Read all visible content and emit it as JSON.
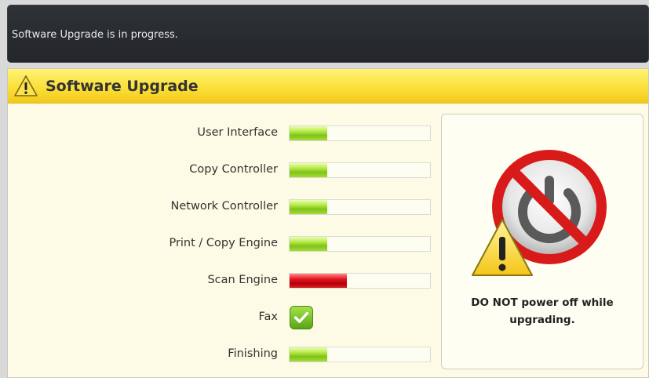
{
  "status_bar": {
    "message": "Software Upgrade is in progress."
  },
  "dialog": {
    "title": "Software Upgrade",
    "title_icon": "warning-icon"
  },
  "components": [
    {
      "label": "User Interface",
      "status": "in-progress",
      "progress": 0.27,
      "color": "#8fd12a"
    },
    {
      "label": "Copy Controller",
      "status": "in-progress",
      "progress": 0.27,
      "color": "#8fd12a"
    },
    {
      "label": "Network Controller",
      "status": "in-progress",
      "progress": 0.27,
      "color": "#8fd12a"
    },
    {
      "label": "Print / Copy Engine",
      "status": "in-progress",
      "progress": 0.27,
      "color": "#8fd12a"
    },
    {
      "label": "Scan Engine",
      "status": "error",
      "progress": 0.41,
      "color": "#d0101a"
    },
    {
      "label": "Fax",
      "status": "complete",
      "icon": "checkmark-icon"
    },
    {
      "label": "Finishing",
      "status": "in-progress",
      "progress": 0.27,
      "color": "#8fd12a"
    }
  ],
  "warning": {
    "icon": "no-power-off-icon",
    "line1": "DO NOT power off while",
    "line2": "upgrading."
  }
}
